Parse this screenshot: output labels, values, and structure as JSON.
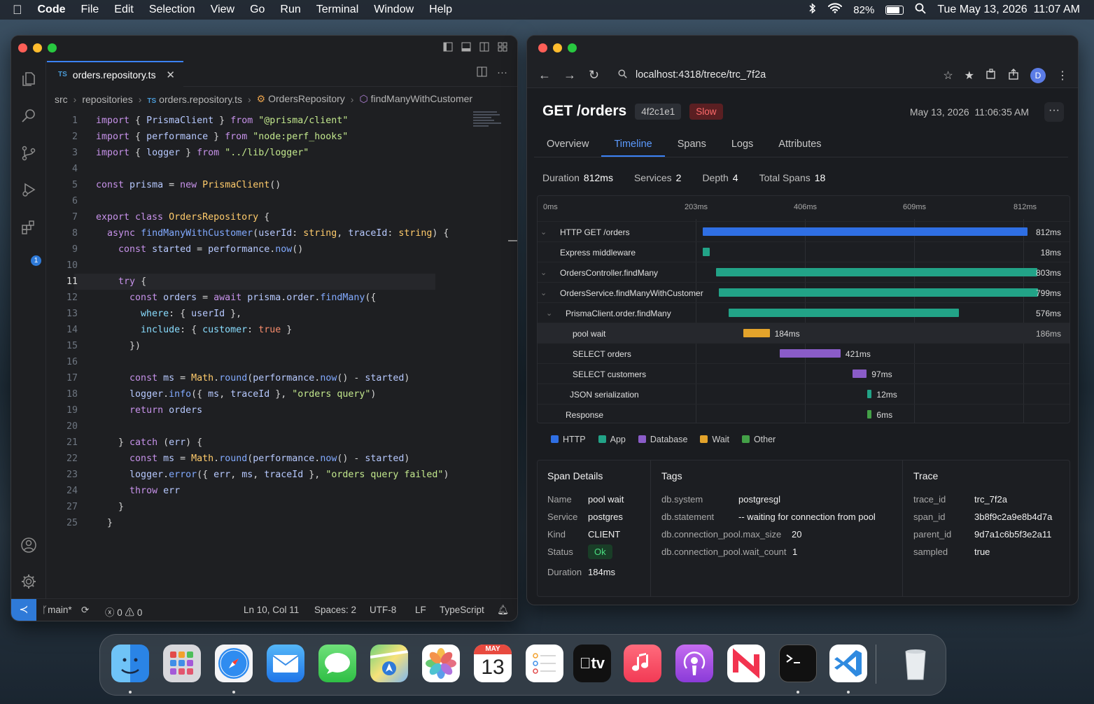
{
  "menubar": {
    "app": "Code",
    "items": [
      "File",
      "Edit",
      "Selection",
      "View",
      "Go",
      "Run",
      "Terminal",
      "Window",
      "Help"
    ],
    "battery": "82%",
    "datetime": "Tue May 13, 2026  11:07 AM"
  },
  "editor": {
    "tab": {
      "lang": "TS",
      "filename": "orders.repository.ts",
      "close": "✕"
    },
    "breadcrumbs": [
      "src",
      "repositories",
      "orders.repository.ts",
      "OrdersRepository",
      "findManyWithCustomer"
    ],
    "line_numbers": [
      "1",
      "2",
      "3",
      "4",
      "5",
      "6",
      "7",
      "8",
      "9",
      "10",
      "11",
      "12",
      "13",
      "14",
      "15",
      "16",
      "17",
      "18",
      "19",
      "20",
      "21",
      "22",
      "23",
      "24",
      "27",
      "25"
    ],
    "code": [
      {
        "ind": "",
        "p": [
          [
            "kw",
            "import"
          ],
          [
            "pl",
            " { "
          ],
          [
            "vr",
            "PrismaClient"
          ],
          [
            "pl",
            " } "
          ],
          [
            "kw",
            "from"
          ],
          [
            "pl",
            " "
          ],
          [
            "st",
            "\"@prisma/client\""
          ]
        ]
      },
      {
        "ind": "",
        "p": [
          [
            "kw",
            "import"
          ],
          [
            "pl",
            " { "
          ],
          [
            "vr",
            "performance"
          ],
          [
            "pl",
            " } "
          ],
          [
            "kw",
            "from"
          ],
          [
            "pl",
            " "
          ],
          [
            "st",
            "\"node:perf_hooks\""
          ]
        ]
      },
      {
        "ind": "",
        "p": [
          [
            "kw",
            "import"
          ],
          [
            "pl",
            " { "
          ],
          [
            "vr",
            "logger"
          ],
          [
            "pl",
            " } "
          ],
          [
            "kw",
            "from"
          ],
          [
            "pl",
            " "
          ],
          [
            "st",
            "\"../lib/logger\""
          ]
        ]
      },
      {
        "ind": "",
        "p": []
      },
      {
        "ind": "",
        "p": [
          [
            "kw",
            "const"
          ],
          [
            "pl",
            " "
          ],
          [
            "vr",
            "prisma"
          ],
          [
            "pl",
            " = "
          ],
          [
            "kw",
            "new"
          ],
          [
            "pl",
            " "
          ],
          [
            "ty",
            "PrismaClient"
          ],
          [
            "pl",
            "()"
          ]
        ]
      },
      {
        "ind": "",
        "p": []
      },
      {
        "ind": "",
        "p": [
          [
            "kw",
            "export class"
          ],
          [
            "pl",
            " "
          ],
          [
            "ty",
            "OrdersRepository"
          ],
          [
            "pl",
            " {"
          ]
        ]
      },
      {
        "ind": "  ",
        "p": [
          [
            "kw",
            "async"
          ],
          [
            "pl",
            " "
          ],
          [
            "fn",
            "findManyWithCustomer"
          ],
          [
            "pl",
            "("
          ],
          [
            "vr",
            "userId"
          ],
          [
            "pl",
            ": "
          ],
          [
            "ty",
            "string"
          ],
          [
            "pl",
            ", "
          ],
          [
            "vr",
            "traceId"
          ],
          [
            "pl",
            ": "
          ],
          [
            "ty",
            "string"
          ],
          [
            "pl",
            ") {"
          ]
        ]
      },
      {
        "ind": "    ",
        "p": [
          [
            "kw",
            "const"
          ],
          [
            "pl",
            " "
          ],
          [
            "vr",
            "started"
          ],
          [
            "pl",
            " = "
          ],
          [
            "vr",
            "performance"
          ],
          [
            "pl",
            "."
          ],
          [
            "fn",
            "now"
          ],
          [
            "pl",
            "()"
          ]
        ]
      },
      {
        "ind": "",
        "p": []
      },
      {
        "ind": "    ",
        "p": [
          [
            "kw",
            "try"
          ],
          [
            "pl",
            " {"
          ]
        ]
      },
      {
        "ind": "      ",
        "p": [
          [
            "kw",
            "const"
          ],
          [
            "pl",
            " "
          ],
          [
            "vr",
            "orders"
          ],
          [
            "pl",
            " = "
          ],
          [
            "kw",
            "await"
          ],
          [
            "pl",
            " "
          ],
          [
            "vr",
            "prisma"
          ],
          [
            "pl",
            "."
          ],
          [
            "vr",
            "order"
          ],
          [
            "pl",
            "."
          ],
          [
            "fn",
            "findMany"
          ],
          [
            "pl",
            "({"
          ]
        ]
      },
      {
        "ind": "        ",
        "p": [
          [
            "cm",
            "where"
          ],
          [
            "pl",
            ": { "
          ],
          [
            "vr",
            "userId"
          ],
          [
            "pl",
            " },"
          ]
        ]
      },
      {
        "ind": "        ",
        "p": [
          [
            "cm",
            "include"
          ],
          [
            "pl",
            ": { "
          ],
          [
            "cm",
            "customer"
          ],
          [
            "pl",
            ": "
          ],
          [
            "bl",
            "true"
          ],
          [
            "pl",
            " }"
          ]
        ]
      },
      {
        "ind": "      ",
        "p": [
          [
            "pl",
            "})"
          ]
        ]
      },
      {
        "ind": "",
        "p": []
      },
      {
        "ind": "      ",
        "p": [
          [
            "kw",
            "const"
          ],
          [
            "pl",
            " "
          ],
          [
            "vr",
            "ms"
          ],
          [
            "pl",
            " = "
          ],
          [
            "ty",
            "Math"
          ],
          [
            "pl",
            "."
          ],
          [
            "fn",
            "round"
          ],
          [
            "pl",
            "("
          ],
          [
            "vr",
            "performance"
          ],
          [
            "pl",
            "."
          ],
          [
            "fn",
            "now"
          ],
          [
            "pl",
            "() - "
          ],
          [
            "vr",
            "started"
          ],
          [
            "pl",
            ")"
          ]
        ]
      },
      {
        "ind": "      ",
        "p": [
          [
            "vr",
            "logger"
          ],
          [
            "pl",
            "."
          ],
          [
            "fn",
            "info"
          ],
          [
            "pl",
            "({ "
          ],
          [
            "vr",
            "ms"
          ],
          [
            "pl",
            ", "
          ],
          [
            "vr",
            "traceId"
          ],
          [
            "pl",
            " }, "
          ],
          [
            "st",
            "\"orders query\""
          ],
          [
            "pl",
            ")"
          ]
        ]
      },
      {
        "ind": "      ",
        "p": [
          [
            "kw",
            "return"
          ],
          [
            "pl",
            " "
          ],
          [
            "vr",
            "orders"
          ]
        ]
      },
      {
        "ind": "",
        "p": []
      },
      {
        "ind": "    ",
        "p": [
          [
            "pl",
            "} "
          ],
          [
            "kw",
            "catch"
          ],
          [
            "pl",
            " ("
          ],
          [
            "vr",
            "err"
          ],
          [
            "pl",
            ") {"
          ]
        ]
      },
      {
        "ind": "      ",
        "p": [
          [
            "kw",
            "const"
          ],
          [
            "pl",
            " "
          ],
          [
            "vr",
            "ms"
          ],
          [
            "pl",
            " = "
          ],
          [
            "ty",
            "Math"
          ],
          [
            "pl",
            "."
          ],
          [
            "fn",
            "round"
          ],
          [
            "pl",
            "("
          ],
          [
            "vr",
            "performance"
          ],
          [
            "pl",
            "."
          ],
          [
            "fn",
            "now"
          ],
          [
            "pl",
            "() - "
          ],
          [
            "vr",
            "started"
          ],
          [
            "pl",
            ")"
          ]
        ]
      },
      {
        "ind": "      ",
        "p": [
          [
            "vr",
            "logger"
          ],
          [
            "pl",
            "."
          ],
          [
            "fn",
            "error"
          ],
          [
            "pl",
            "({ "
          ],
          [
            "vr",
            "err"
          ],
          [
            "pl",
            ", "
          ],
          [
            "vr",
            "ms"
          ],
          [
            "pl",
            ", "
          ],
          [
            "vr",
            "traceId"
          ],
          [
            "pl",
            " }, "
          ],
          [
            "st",
            "\"orders query failed\""
          ],
          [
            "pl",
            ")"
          ]
        ]
      },
      {
        "ind": "      ",
        "p": [
          [
            "kw",
            "throw"
          ],
          [
            "pl",
            " "
          ],
          [
            "vr",
            "err"
          ]
        ]
      },
      {
        "ind": "    ",
        "p": [
          [
            "pl",
            "}"
          ]
        ]
      },
      {
        "ind": "  ",
        "p": [
          [
            "pl",
            "}"
          ]
        ]
      }
    ],
    "status": {
      "branch": "main*",
      "errors": "0",
      "warnings": "0",
      "position": "Ln 10, Col 11",
      "spaces": "Spaces: 2",
      "encoding": "UTF-8",
      "eol": "LF",
      "language": "TypeScript"
    },
    "extensions_badge": "1"
  },
  "browser": {
    "url": "localhost:4318/trece/trc_7f2a",
    "avatar": "D",
    "title": "GET /orders",
    "trace_short": "4f2c1e1",
    "slow": "Slow",
    "date": "May 13, 2026  11:06:35 AM",
    "tabs": [
      "Overview",
      "Timeline",
      "Spans",
      "Logs",
      "Attributes"
    ],
    "active_tab": "Timeline",
    "stats": [
      {
        "k": "Duration",
        "v": "812ms"
      },
      {
        "k": "Services",
        "v": "2"
      },
      {
        "k": "Depth",
        "v": "4"
      },
      {
        "k": "Total Spans",
        "v": "18"
      }
    ],
    "ticks": [
      "0ms",
      "203ms",
      "406ms",
      "609ms",
      "812ms"
    ],
    "colors": {
      "HTTP": "#2f6fe4",
      "App": "#22a387",
      "Database": "#8a5cc8",
      "Wait": "#e3a32b",
      "Other": "#43a047"
    },
    "spans": [
      {
        "name": "HTTP GET /orders",
        "caret": "⌄",
        "type": "HTTP",
        "start": 0,
        "dur": 812,
        "label": "812ms",
        "inside": false
      },
      {
        "name": "Express middleware",
        "caret": "",
        "type": "App",
        "start": 0,
        "dur": 18,
        "label": "18ms",
        "inside": false
      },
      {
        "name": "OrdersController.findMany",
        "caret": "⌄",
        "type": "App",
        "start": 33,
        "dur": 803,
        "label": "803ms",
        "inside": false
      },
      {
        "name": "OrdersService.findManyWithCustomer",
        "caret": "⌄",
        "type": "App",
        "start": 40,
        "dur": 799,
        "label": "799ms",
        "inside": false
      },
      {
        "name": "PrismaClient.order.findMany",
        "caret": "⌄",
        "type": "App",
        "start": 64,
        "dur": 576,
        "label": "576ms",
        "inside": false
      },
      {
        "name": "pool wait",
        "caret": "",
        "type": "Wait",
        "start": 101,
        "dur": 184,
        "label": "184ms",
        "inside": true,
        "right": "186ms"
      },
      {
        "name": "SELECT orders",
        "caret": "",
        "type": "Database",
        "start": 193,
        "dur": 421,
        "label": "421ms",
        "inside": true
      },
      {
        "name": "SELECT customers",
        "caret": "",
        "type": "Database",
        "start": 375,
        "dur": 97,
        "label": "97ms",
        "inside": true
      },
      {
        "name": "JSON serialization",
        "caret": "",
        "type": "App",
        "start": 412,
        "dur": 12,
        "label": "12ms",
        "inside": true
      },
      {
        "name": "Response",
        "caret": "",
        "type": "Other",
        "start": 412,
        "dur": 6,
        "label": "6ms",
        "inside": true
      }
    ],
    "legend": [
      "HTTP",
      "App",
      "Database",
      "Wait",
      "Other"
    ],
    "span_details": {
      "title": "Span Details",
      "rows": [
        {
          "k": "Name",
          "v": "pool wait"
        },
        {
          "k": "Service",
          "v": "postgres"
        },
        {
          "k": "Kind",
          "v": "CLIENT"
        },
        {
          "k": "Status",
          "v": "Ok"
        },
        {
          "k": "Duration",
          "v": "184ms"
        }
      ]
    },
    "tags": {
      "title": "Tags",
      "rows": [
        {
          "k": "db.system",
          "v": "postgresgl"
        },
        {
          "k": "db.statement",
          "v": "-- waiting for connection from pool"
        },
        {
          "k": "db.connection_pool.max_size",
          "v": "20"
        },
        {
          "k": "db.connection_pool.wait_count",
          "v": "1"
        }
      ]
    },
    "trace": {
      "title": "Trace",
      "rows": [
        {
          "k": "trace_id",
          "v": "trc_7f2a"
        },
        {
          "k": "span_id",
          "v": "3b8f9c2a9e8b4d7a"
        },
        {
          "k": "parent_id",
          "v": "9d7a1c6b5f3e2a11"
        },
        {
          "k": "sampled",
          "v": "true"
        }
      ]
    }
  },
  "dock": {
    "calendar_month": "MAY",
    "calendar_day": "13",
    "tv_label": "tv"
  }
}
